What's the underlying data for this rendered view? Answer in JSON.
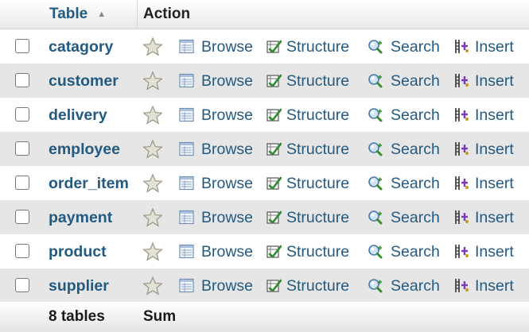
{
  "header": {
    "table_label": "Table",
    "sort_glyph": "▲",
    "action_label": "Action"
  },
  "actions": {
    "browse": "Browse",
    "structure": "Structure",
    "search": "Search",
    "insert": "Insert"
  },
  "rows": [
    {
      "name": "catagory"
    },
    {
      "name": "customer"
    },
    {
      "name": "delivery"
    },
    {
      "name": "employee"
    },
    {
      "name": "order_item"
    },
    {
      "name": "payment"
    },
    {
      "name": "product"
    },
    {
      "name": "supplier"
    }
  ],
  "footer": {
    "count_label": "8 tables",
    "sum_label": "Sum"
  },
  "icons": [
    "favorite-star-icon",
    "browse-icon",
    "structure-icon",
    "search-icon",
    "insert-icon"
  ],
  "colors": {
    "link": "#235a81",
    "row_alt": "#e6e6e6"
  }
}
